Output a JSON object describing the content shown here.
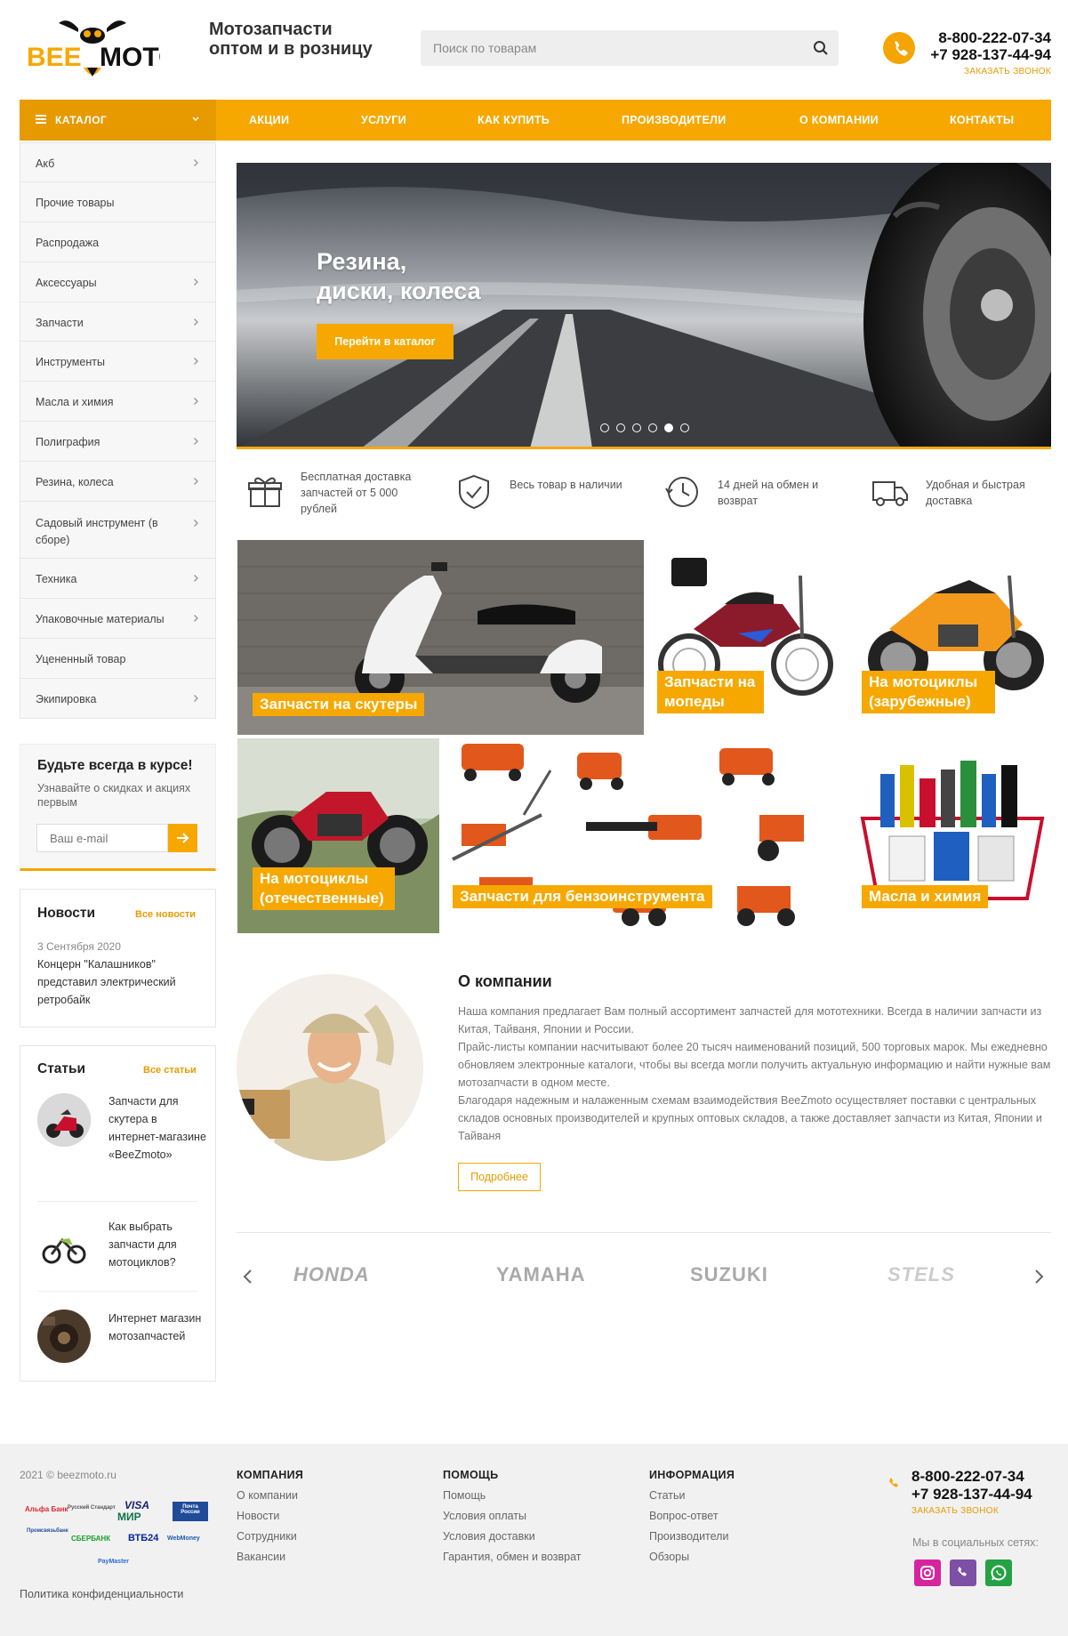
{
  "header": {
    "logo_text_a": "BEE",
    "logo_text_b": "MOTO",
    "tagline_1": "Мотозапчасти",
    "tagline_2": "оптом и в розницу",
    "search_placeholder": "Поиск по товарам",
    "phone_1": "8-800-222-07-34",
    "phone_2": "+7 928-137-44-94",
    "callback": "ЗАКАЗАТЬ ЗВОНОК"
  },
  "nav": {
    "catalog": "КАТАЛОГ",
    "items": [
      "АКЦИИ",
      "УСЛУГИ",
      "КАК КУПИТЬ",
      "ПРОИЗВОДИТЕЛИ",
      "О КОМПАНИИ",
      "КОНТАКТЫ"
    ]
  },
  "sidebar": {
    "items": [
      {
        "label": "Акб",
        "arrow": true
      },
      {
        "label": "Прочие товары",
        "arrow": false
      },
      {
        "label": "Распродажа",
        "arrow": false
      },
      {
        "label": "Аксессуары",
        "arrow": true
      },
      {
        "label": "Запчасти",
        "arrow": true
      },
      {
        "label": "Инструменты",
        "arrow": true
      },
      {
        "label": "Масла и химия",
        "arrow": true
      },
      {
        "label": "Полиграфия",
        "arrow": true
      },
      {
        "label": "Резина, колеса",
        "arrow": true
      },
      {
        "label": "Садовый инструмент (в сборе)",
        "arrow": true
      },
      {
        "label": "Техника",
        "arrow": true
      },
      {
        "label": "Упаковочные материалы",
        "arrow": true
      },
      {
        "label": "Уцененный товар",
        "arrow": false
      },
      {
        "label": "Экипировка",
        "arrow": true
      }
    ]
  },
  "subscribe": {
    "title": "Будьте всегда в курсе!",
    "text": "Узнавайте о скидках и акциях первым",
    "placeholder": "Ваш e-mail"
  },
  "news": {
    "title": "Новости",
    "all": "Все новости",
    "date": "3 Сентября 2020",
    "text": "Концерн \"Калашников\" представил электрический ретробайк"
  },
  "articles": {
    "title": "Статьи",
    "all": "Все статьи",
    "items": [
      "Запчасти для скутера в интернет-магазине «BeeZmoto»",
      "Как выбрать запчасти для мотоциклов?",
      "Интернет магазин мотозапчастей"
    ]
  },
  "banner": {
    "title_1": "Резина,",
    "title_2": "диски, колеса",
    "button": "Перейти в каталог",
    "slides": 6,
    "active_slide": 5
  },
  "features": [
    "Бесплатная доставка запчастей от 5 000 рублей",
    "Весь товар в наличии",
    "14 дней на обмен и возврат",
    "Удобная и быстрая доставка"
  ],
  "categories": [
    "Запчасти на скутеры",
    "Запчасти на мопеды",
    "На мотоциклы (зарубежные)",
    "На мотоциклы (отечественные)",
    "Запчасти для бензоинструмента",
    "Масла и химия"
  ],
  "about": {
    "title": "О компании",
    "p1": "Наша компания предлагает Вам полный ассортимент запчастей для мототехники. Всегда в наличии запчасти из Китая, Тайваня, Японии и России.",
    "p2": "Прайс-листы компании насчитывают более 20 тысяч наименований позиций, 500 торговых марок. Мы ежедневно обновляем электронные каталоги, чтобы вы всегда могли получить актуальную информацию и найти нужные вам мотозапчасти в одном месте.",
    "p3": "Благодаря надежным и налаженным схемам взаимодействия BeeZmoto осуществляет поставки с центральных складов основных производителей и крупных оптовых складов, а также доставляет запчасти из Китая, Японии и Тайваня",
    "button": "Подробнее"
  },
  "brands": [
    "HONDA",
    "YAMAHA",
    "SUZUKI",
    "STELS"
  ],
  "footer": {
    "copyright": "2021 © beezmoto.ru",
    "policy": "Политика конфиденциальности",
    "payments": [
      "Альфа Банк",
      "Русский Стандарт",
      "VISA",
      "МИР",
      "Почта России",
      "Промсвязьбанк",
      "СБЕРБАНК",
      "ВТБ24",
      "WebMoney",
      "PayMaster"
    ],
    "col1_title": "КОМПАНИЯ",
    "col1": [
      "О компании",
      "Новости",
      "Сотрудники",
      "Вакансии"
    ],
    "col2_title": "ПОМОЩЬ",
    "col2": [
      "Помощь",
      "Условия оплаты",
      "Условия доставки",
      "Гарантия, обмен и возврат"
    ],
    "col3_title": "ИНФОРМАЦИЯ",
    "col3": [
      "Статьи",
      "Вопрос-ответ",
      "Производители",
      "Обзоры"
    ],
    "phone_1": "8-800-222-07-34",
    "phone_2": "+7 928-137-44-94",
    "callback": "ЗАКАЗАТЬ ЗВОНОК",
    "social_title": "Мы в социальных сетях:"
  },
  "colors": {
    "accent": "#f6a800",
    "accent_dark": "#e79a00"
  }
}
